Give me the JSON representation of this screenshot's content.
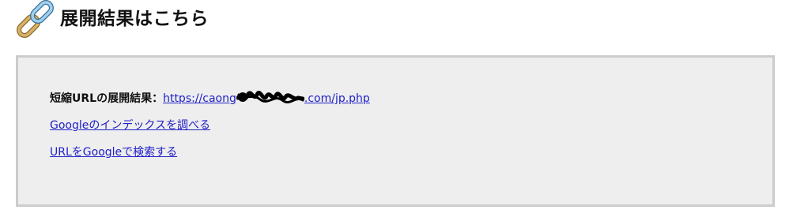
{
  "heading": {
    "icon": "chain-link-icon",
    "title": "展開結果はこちら"
  },
  "result": {
    "label": "短縮URLの展開結果：",
    "url_prefix": "https://caong",
    "url_suffix": ".com/jp.php",
    "links": {
      "google_index": "Googleのインデックスを調べる",
      "google_search": "URLをGoogleで検索する"
    }
  },
  "colors": {
    "box_background": "#eeeeee",
    "box_border": "#cccccc",
    "link": "#2020c8"
  }
}
